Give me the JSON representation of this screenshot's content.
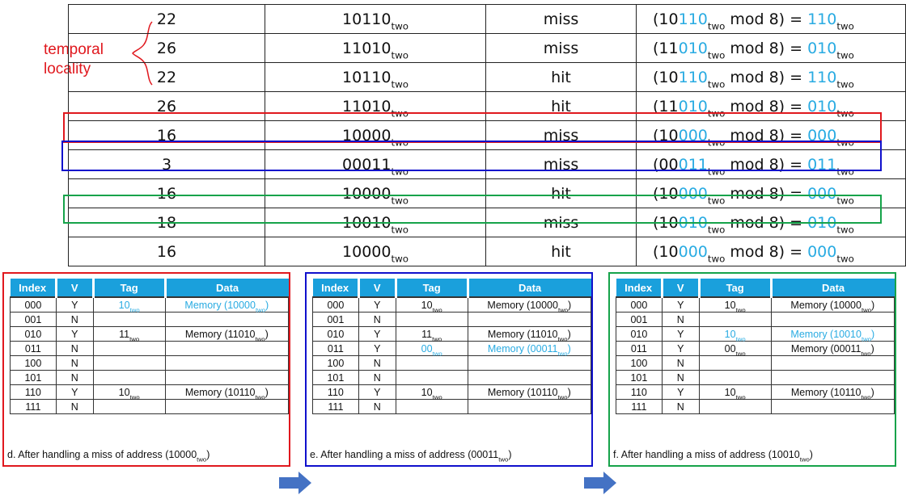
{
  "annotation": {
    "line1": "temporal",
    "line2": "locality"
  },
  "accesses": [
    {
      "addr": "22",
      "bin": "10110",
      "result": "miss",
      "pre": "10",
      "hl": "110",
      "eq": "110"
    },
    {
      "addr": "26",
      "bin": "11010",
      "result": "miss",
      "pre": "11",
      "hl": "010",
      "eq": "010"
    },
    {
      "addr": "22",
      "bin": "10110",
      "result": "hit",
      "pre": "10",
      "hl": "110",
      "eq": "110"
    },
    {
      "addr": "26",
      "bin": "11010",
      "result": "hit",
      "pre": "11",
      "hl": "010",
      "eq": "010"
    },
    {
      "addr": "16",
      "bin": "10000",
      "result": "miss",
      "pre": "10",
      "hl": "000",
      "eq": "000"
    },
    {
      "addr": "3",
      "bin": "00011",
      "result": "miss",
      "pre": "00",
      "hl": "011",
      "eq": "011"
    },
    {
      "addr": "16",
      "bin": "10000",
      "result": "hit",
      "pre": "10",
      "hl": "000",
      "eq": "000"
    },
    {
      "addr": "18",
      "bin": "10010",
      "result": "miss",
      "pre": "10",
      "hl": "010",
      "eq": "010"
    },
    {
      "addr": "16",
      "bin": "10000",
      "result": "hit",
      "pre": "10",
      "hl": "000",
      "eq": "000"
    }
  ],
  "sub_two": "two",
  "mod_text": " mod 8) = ",
  "headers": [
    "Index",
    "V",
    "Tag",
    "Data"
  ],
  "panels": [
    {
      "caption_pre": "d. After handling a miss of address (10000",
      "caption_post": ")",
      "rows": [
        {
          "index": "000",
          "v": "Y",
          "tag": "10",
          "data": "Memory (10000",
          "highlight": true
        },
        {
          "index": "001",
          "v": "N",
          "tag": "",
          "data": ""
        },
        {
          "index": "010",
          "v": "Y",
          "tag": "11",
          "data": "Memory (11010"
        },
        {
          "index": "011",
          "v": "N",
          "tag": "",
          "data": ""
        },
        {
          "index": "100",
          "v": "N",
          "tag": "",
          "data": ""
        },
        {
          "index": "101",
          "v": "N",
          "tag": "",
          "data": ""
        },
        {
          "index": "110",
          "v": "Y",
          "tag": "10",
          "data": "Memory (10110"
        },
        {
          "index": "111",
          "v": "N",
          "tag": "",
          "data": ""
        }
      ]
    },
    {
      "caption_pre": "e. After handling a miss of address (00011",
      "caption_post": ")",
      "rows": [
        {
          "index": "000",
          "v": "Y",
          "tag": "10",
          "data": "Memory (10000"
        },
        {
          "index": "001",
          "v": "N",
          "tag": "",
          "data": ""
        },
        {
          "index": "010",
          "v": "Y",
          "tag": "11",
          "data": "Memory (11010"
        },
        {
          "index": "011",
          "v": "Y",
          "tag": "00",
          "data": "Memory (00011",
          "highlight": true
        },
        {
          "index": "100",
          "v": "N",
          "tag": "",
          "data": ""
        },
        {
          "index": "101",
          "v": "N",
          "tag": "",
          "data": ""
        },
        {
          "index": "110",
          "v": "Y",
          "tag": "10",
          "data": "Memory (10110"
        },
        {
          "index": "111",
          "v": "N",
          "tag": "",
          "data": ""
        }
      ]
    },
    {
      "caption_pre": "f. After handling a miss of address (10010",
      "caption_post": ")",
      "rows": [
        {
          "index": "000",
          "v": "Y",
          "tag": "10",
          "data": "Memory (10000"
        },
        {
          "index": "001",
          "v": "N",
          "tag": "",
          "data": ""
        },
        {
          "index": "010",
          "v": "Y",
          "tag": "10",
          "data": "Memory (10010",
          "highlight": true
        },
        {
          "index": "011",
          "v": "Y",
          "tag": "00",
          "data": "Memory (00011"
        },
        {
          "index": "100",
          "v": "N",
          "tag": "",
          "data": ""
        },
        {
          "index": "101",
          "v": "N",
          "tag": "",
          "data": ""
        },
        {
          "index": "110",
          "v": "Y",
          "tag": "10",
          "data": "Memory (10110"
        },
        {
          "index": "111",
          "v": "N",
          "tag": "",
          "data": ""
        }
      ]
    }
  ],
  "colors": {
    "highlight": "#29abe2",
    "annotation": "#e0181e",
    "header_bg": "#1aa0dc",
    "box_d": "#e0181e",
    "box_e": "#1010cc",
    "box_f": "#16a34a",
    "arrow": "#4472c4"
  }
}
